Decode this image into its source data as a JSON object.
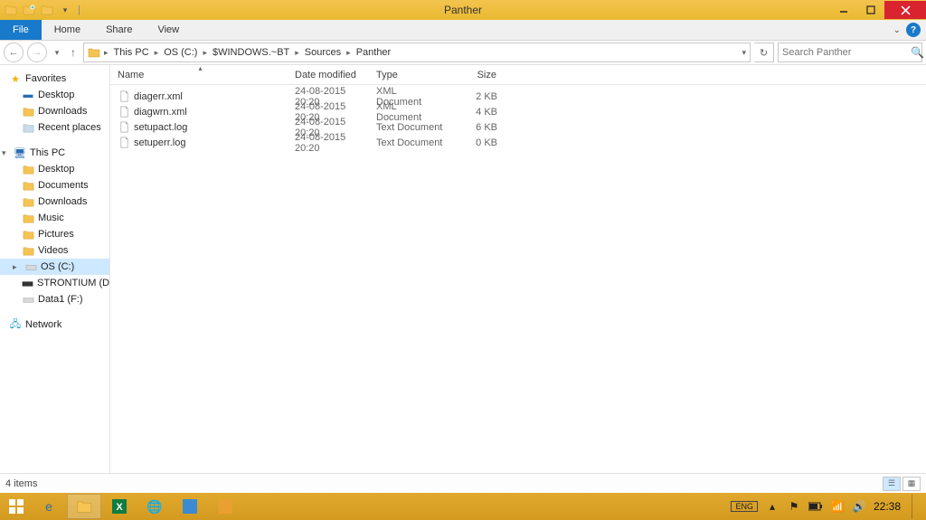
{
  "window": {
    "title": "Panther"
  },
  "ribbon": {
    "file": "File",
    "home": "Home",
    "share": "Share",
    "view": "View"
  },
  "breadcrumb": [
    "This PC",
    "OS (C:)",
    "$WINDOWS.~BT",
    "Sources",
    "Panther"
  ],
  "search": {
    "placeholder": "Search Panther"
  },
  "nav": {
    "favorites": {
      "label": "Favorites",
      "items": [
        {
          "label": "Desktop",
          "icon": "monitor"
        },
        {
          "label": "Downloads",
          "icon": "folder"
        },
        {
          "label": "Recent places",
          "icon": "folder"
        }
      ]
    },
    "thispc": {
      "label": "This PC",
      "items": [
        {
          "label": "Desktop",
          "icon": "folder"
        },
        {
          "label": "Documents",
          "icon": "folder"
        },
        {
          "label": "Downloads",
          "icon": "folder"
        },
        {
          "label": "Music",
          "icon": "folder"
        },
        {
          "label": "Pictures",
          "icon": "folder"
        },
        {
          "label": "Videos",
          "icon": "folder"
        },
        {
          "label": "OS (C:)",
          "icon": "drive",
          "selected": true
        },
        {
          "label": "STRONTIUM (D:)",
          "icon": "drive"
        },
        {
          "label": "Data1 (F:)",
          "icon": "drive"
        }
      ]
    },
    "network": {
      "label": "Network"
    }
  },
  "columns": {
    "name": "Name",
    "date": "Date modified",
    "type": "Type",
    "size": "Size"
  },
  "files": [
    {
      "name": "diagerr.xml",
      "date": "24-08-2015 20:20",
      "type": "XML Document",
      "size": "2 KB",
      "icon": "xml"
    },
    {
      "name": "diagwrn.xml",
      "date": "24-08-2015 20:20",
      "type": "XML Document",
      "size": "4 KB",
      "icon": "xml"
    },
    {
      "name": "setupact.log",
      "date": "24-08-2015 20:20",
      "type": "Text Document",
      "size": "6 KB",
      "icon": "txt"
    },
    {
      "name": "setuperr.log",
      "date": "24-08-2015 20:20",
      "type": "Text Document",
      "size": "0 KB",
      "icon": "txt"
    }
  ],
  "status": {
    "count": "4 items"
  },
  "taskbar": {
    "keyboard": "ENG",
    "clock": "22:38"
  }
}
